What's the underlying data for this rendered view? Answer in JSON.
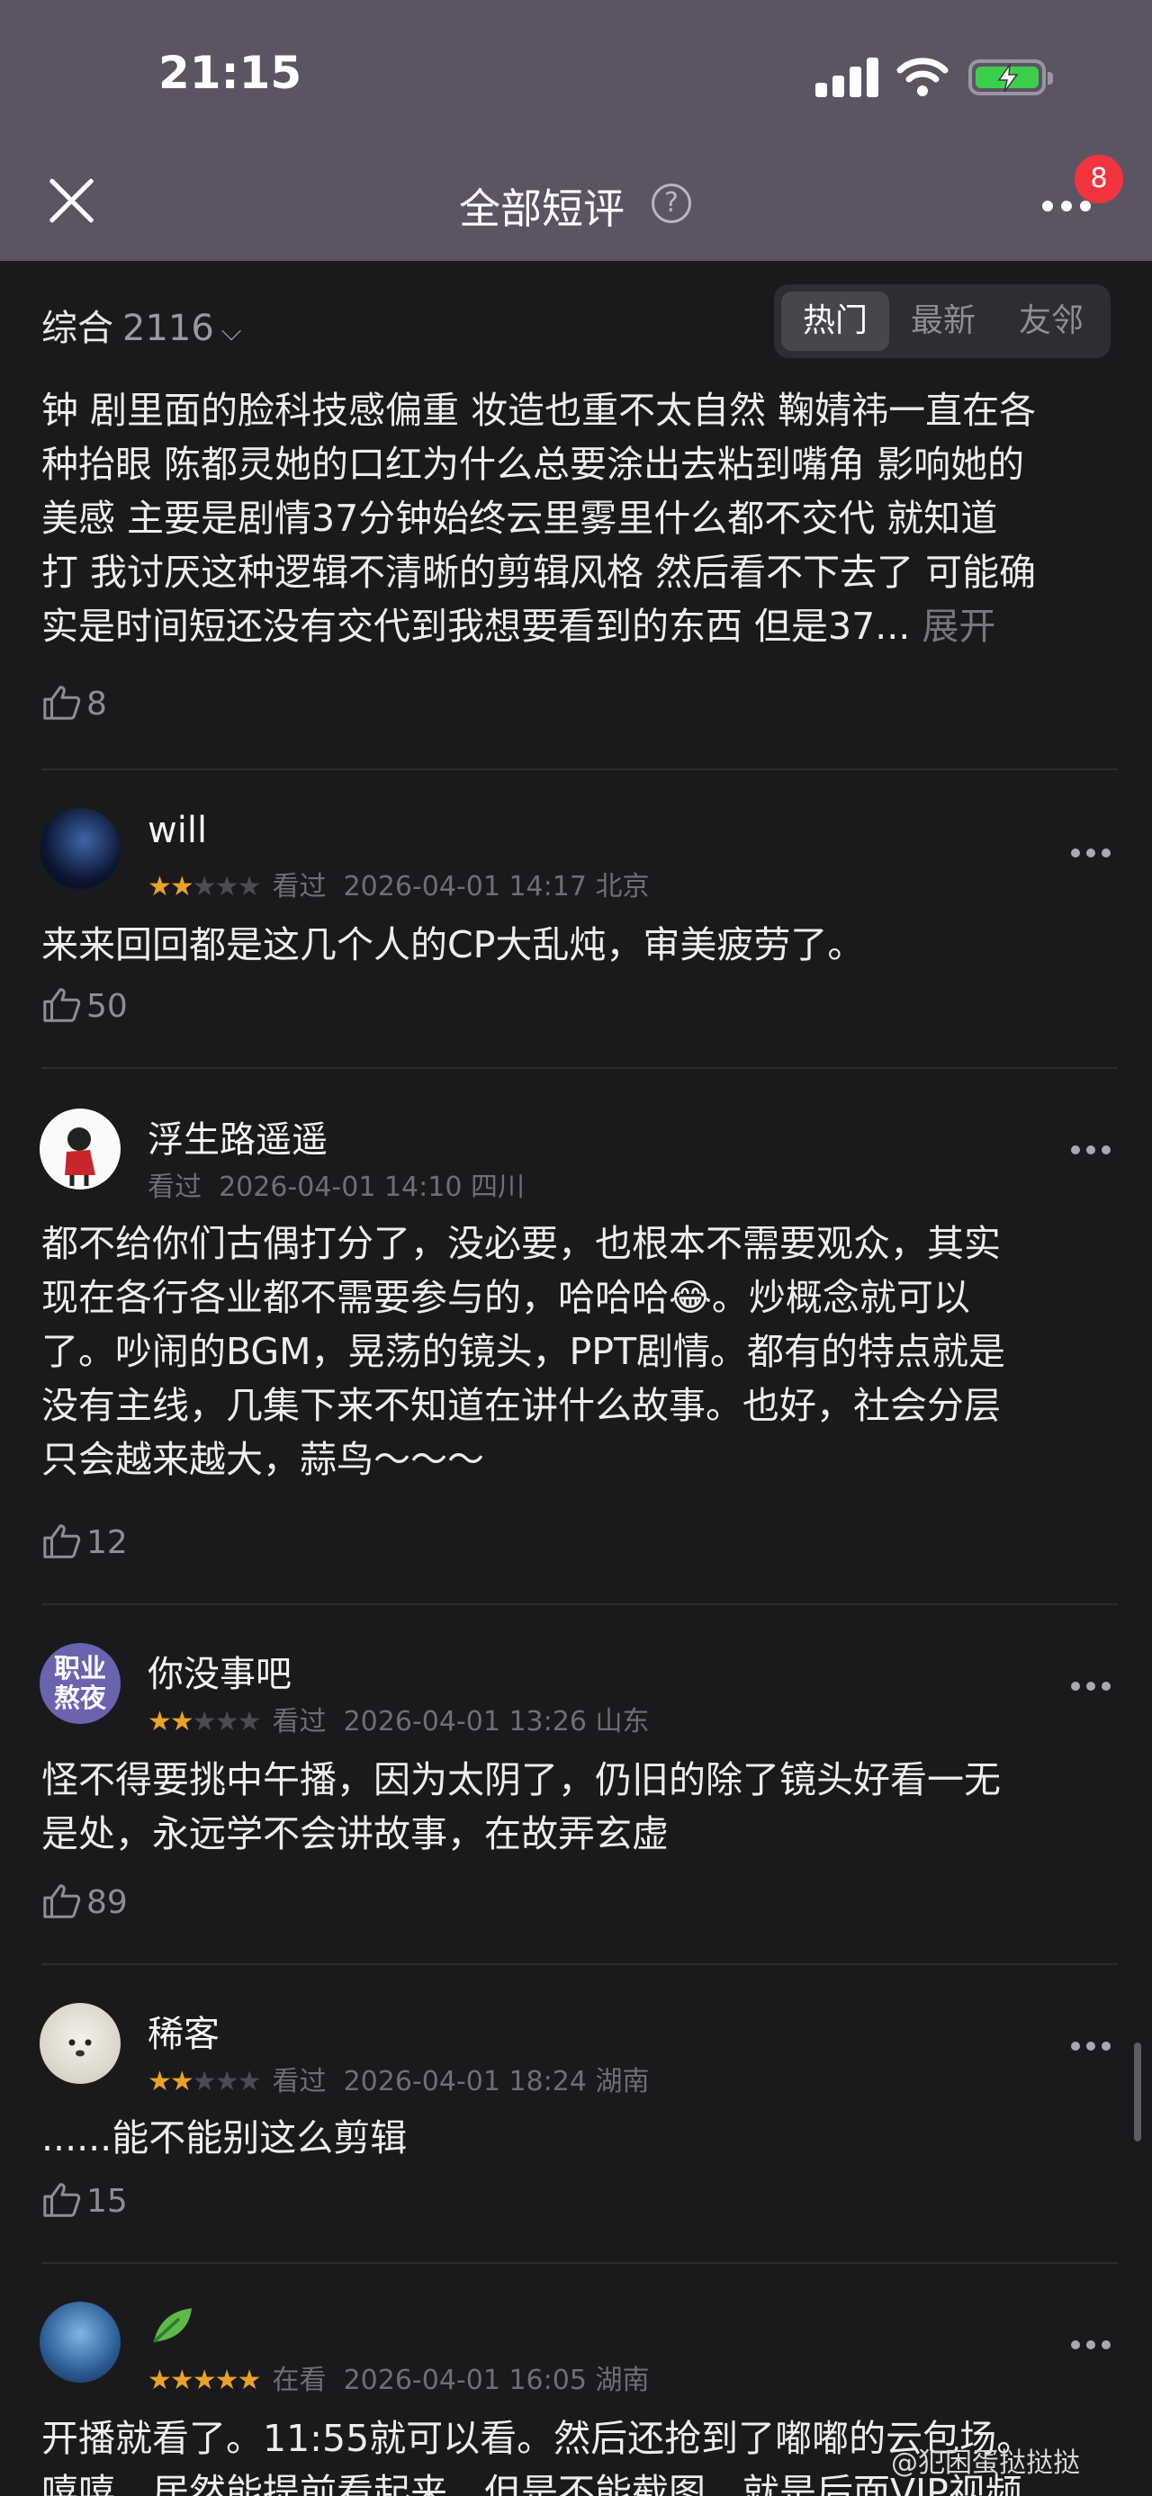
{
  "status_bar": {
    "time": "21:15"
  },
  "nav": {
    "title": "全部短评",
    "help_glyph": "?",
    "badge_count": "8"
  },
  "filter": {
    "sort_label": "综合",
    "count": "2116",
    "tabs": [
      {
        "label": "热门",
        "active": true
      },
      {
        "label": "最新",
        "active": false
      },
      {
        "label": "友邻",
        "active": false
      }
    ]
  },
  "first_review": {
    "lines": [
      "钟 剧里面的脸科技感偏重 妆造也重不太自然 鞠婧祎一直在各",
      "种抬眼 陈都灵她的口红为什么总要涂出去粘到嘴角 影响她的",
      "美感 主要是剧情37分钟始终云里雾里什么都不交代 就知道",
      "打 我讨厌这种逻辑不清晰的剪辑风格 然后看不下去了 可能确",
      "实是时间短还没有交代到我想要看到的东西 但是37..."
    ],
    "expand": "展开",
    "likes": "8"
  },
  "reviews": [
    {
      "user": "will",
      "rating": 2,
      "status": "看过",
      "time": "2026-04-01 14:17",
      "location": "北京",
      "lines": [
        "来来回回都是这几个人的CP大乱炖，审美疲劳了。"
      ],
      "likes": "50"
    },
    {
      "user": "浮生路遥遥",
      "rating": 0,
      "status": "看过",
      "time": "2026-04-01 14:10",
      "location": "四川",
      "lines": [
        "都不给你们古偶打分了，没必要，也根本不需要观众，其实",
        "现在各行各业都不需要参与的，哈哈哈😂。炒概念就可以",
        "了。吵闹的BGM，晃荡的镜头，PPT剧情。都有的特点就是",
        "没有主线，几集下来不知道在讲什么故事。也好，社会分层",
        "只会越来越大，蒜鸟～～～"
      ],
      "likes": "12"
    },
    {
      "user": "你没事吧",
      "avatar_text": "职业熬夜",
      "rating": 2,
      "status": "看过",
      "time": "2026-04-01 13:26",
      "location": "山东",
      "lines": [
        "怪不得要挑中午播，因为太阴了，仍旧的除了镜头好看一无",
        "是处，永远学不会讲故事，在故弄玄虚"
      ],
      "likes": "89"
    },
    {
      "user": "稀客",
      "rating": 2,
      "status": "看过",
      "time": "2026-04-01 18:24",
      "location": "湖南",
      "lines": [
        "......能不能别这么剪辑"
      ],
      "likes": "15"
    },
    {
      "user": "",
      "rating": 5,
      "status": "在看",
      "time": "2026-04-01 16:05",
      "location": "湖南",
      "lines": [
        "开播就看了。11:55就可以看。然后还抢到了嘟嘟的云包场。",
        "嘻嘻，居然能提前看起来，但是不能截图，就是后面VIP视频"
      ],
      "likes": ""
    }
  ],
  "watermark": "@犯困蛋挞挞挞",
  "colors": {
    "nav_bg": "#5b5563",
    "page_bg": "#1a1a1c",
    "star": "#e9a228",
    "badge": "#f2343e"
  }
}
